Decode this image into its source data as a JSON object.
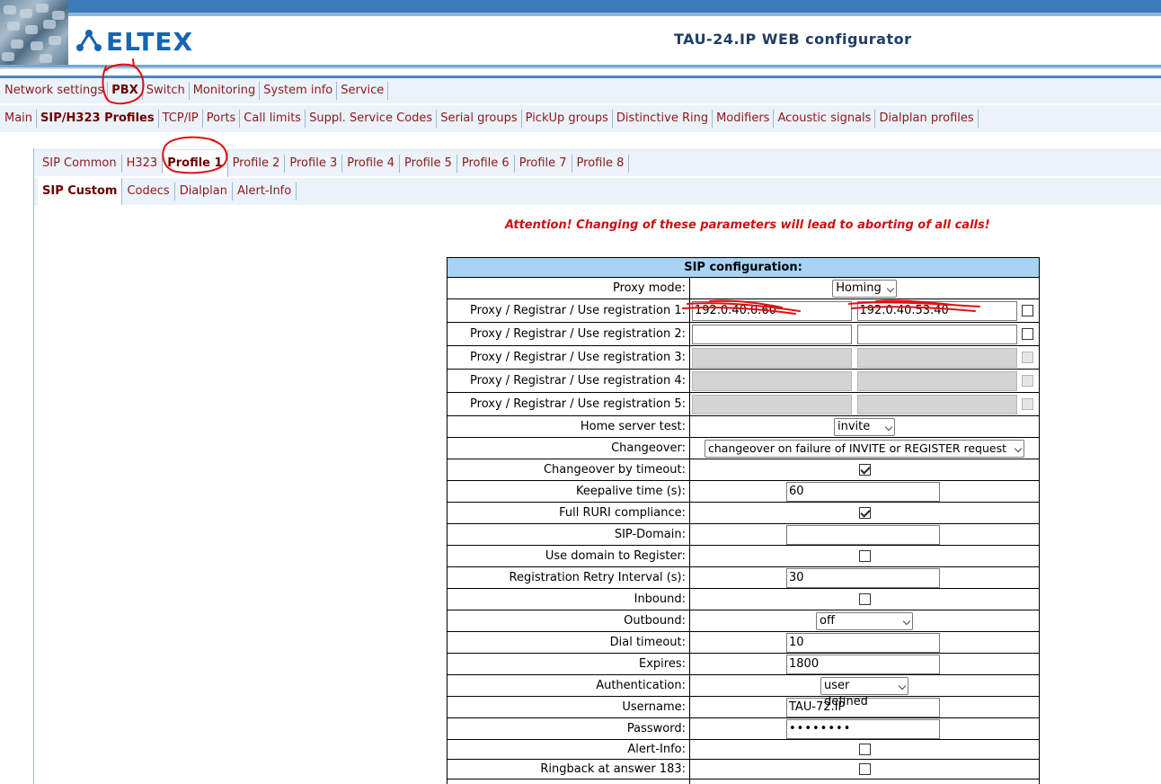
{
  "app": {
    "logo_text": "ELTEX",
    "title": "TAU-24.IP WEB configurator"
  },
  "menu_main": [
    {
      "label": "Network settings",
      "active": false
    },
    {
      "label": "PBX",
      "active": true
    },
    {
      "label": "Switch",
      "active": false
    },
    {
      "label": "Monitoring",
      "active": false
    },
    {
      "label": "System info",
      "active": false
    },
    {
      "label": "Service",
      "active": false
    }
  ],
  "menu_pbx": [
    {
      "label": "Main",
      "active": false
    },
    {
      "label": "SIP/H323 Profiles",
      "active": true
    },
    {
      "label": "TCP/IP",
      "active": false
    },
    {
      "label": "Ports",
      "active": false
    },
    {
      "label": "Call limits",
      "active": false
    },
    {
      "label": "Suppl. Service Codes",
      "active": false
    },
    {
      "label": "Serial groups",
      "active": false
    },
    {
      "label": "PickUp groups",
      "active": false
    },
    {
      "label": "Distinctive Ring",
      "active": false
    },
    {
      "label": "Modifiers",
      "active": false
    },
    {
      "label": "Acoustic signals",
      "active": false
    },
    {
      "label": "Dialplan profiles",
      "active": false
    }
  ],
  "profile_tabs": [
    {
      "label": "SIP Common"
    },
    {
      "label": "H323"
    },
    {
      "label": "Profile 1"
    },
    {
      "label": "Profile 2"
    },
    {
      "label": "Profile 3"
    },
    {
      "label": "Profile 4"
    },
    {
      "label": "Profile 5"
    },
    {
      "label": "Profile 6"
    },
    {
      "label": "Profile 7"
    },
    {
      "label": "Profile 8"
    }
  ],
  "sub_tabs": [
    {
      "label": "SIP Custom"
    },
    {
      "label": "Codecs"
    },
    {
      "label": "Dialplan"
    },
    {
      "label": "Alert-Info"
    }
  ],
  "attention": "Attention! Changing of these parameters will lead to aborting of all calls!",
  "config": {
    "header": "SIP configuration:",
    "proxy_mode": {
      "label": "Proxy mode:",
      "value": "Homing"
    },
    "registrations": [
      {
        "label": "Proxy / Registrar / Use registration 1:",
        "proxy": "192.0.40.0.60",
        "registrar": "192.0.40.53.40",
        "checked": false,
        "disabled": false
      },
      {
        "label": "Proxy / Registrar / Use registration 2:",
        "proxy": "",
        "registrar": "",
        "checked": false,
        "disabled": false
      },
      {
        "label": "Proxy / Registrar / Use registration 3:",
        "proxy": "",
        "registrar": "",
        "checked": false,
        "disabled": true
      },
      {
        "label": "Proxy / Registrar / Use registration 4:",
        "proxy": "",
        "registrar": "",
        "checked": false,
        "disabled": true
      },
      {
        "label": "Proxy / Registrar / Use registration 5:",
        "proxy": "",
        "registrar": "",
        "checked": false,
        "disabled": true
      }
    ],
    "home_server_test": {
      "label": "Home server test:",
      "value": "invite"
    },
    "changeover": {
      "label": "Changeover:",
      "value": "changeover on failure of INVITE or REGISTER request"
    },
    "changeover_timeout": {
      "label": "Changeover by timeout:",
      "checked": true
    },
    "keepalive": {
      "label": "Keepalive time (s):",
      "value": "60"
    },
    "full_ruri": {
      "label": "Full RURI compliance:",
      "checked": true
    },
    "sip_domain": {
      "label": "SIP-Domain:",
      "value": ""
    },
    "use_domain": {
      "label": "Use domain to Register:",
      "checked": false
    },
    "retry_interval": {
      "label": "Registration Retry Interval (s):",
      "value": "30"
    },
    "inbound": {
      "label": "Inbound:",
      "checked": false
    },
    "outbound": {
      "label": "Outbound:",
      "value": "off"
    },
    "dial_timeout": {
      "label": "Dial timeout:",
      "value": "10"
    },
    "expires": {
      "label": "Expires:",
      "value": "1800"
    },
    "authentication": {
      "label": "Authentication:",
      "value": "user defined"
    },
    "username": {
      "label": "Username:",
      "value": "TAU-72.IP"
    },
    "password": {
      "label": "Password:",
      "value": "••••••••"
    },
    "alert_info": {
      "label": "Alert-Info:",
      "checked": false
    },
    "ringback_183": {
      "label": "Ringback at answer 183:",
      "checked": false
    }
  },
  "colors": {
    "brand": "#1565b3",
    "menu_text": "#8b1a1a",
    "attention": "#d01010",
    "table_header": "#a7d3f5",
    "bar_bg": "#ebf2f9"
  }
}
